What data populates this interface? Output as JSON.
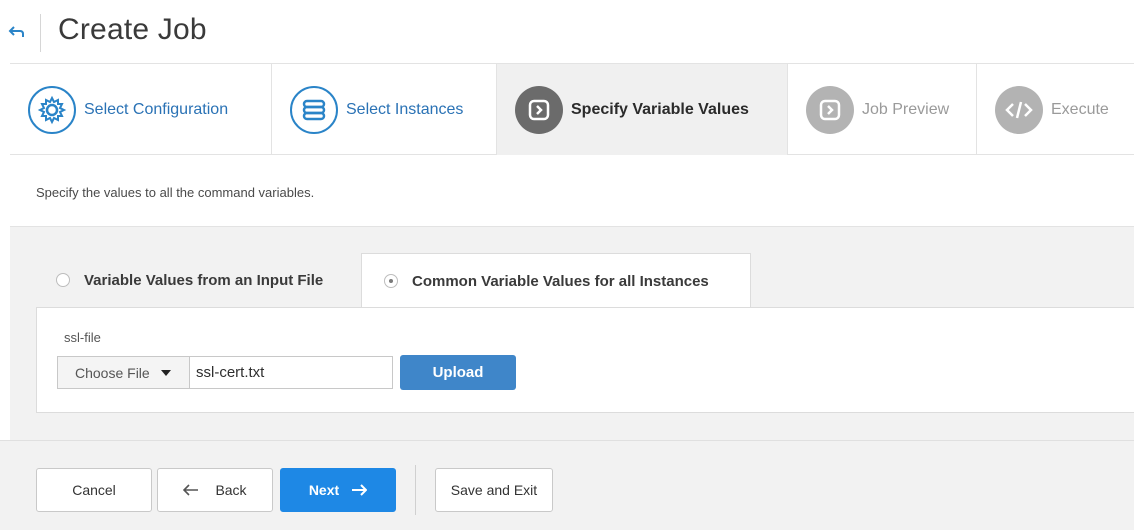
{
  "header": {
    "title": "Create Job",
    "back_icon": "back-arrow-icon"
  },
  "wizard": {
    "steps": [
      {
        "label": "Select Configuration",
        "state": "done",
        "icon": "gear-icon"
      },
      {
        "label": "Select Instances",
        "state": "done",
        "icon": "database-icon"
      },
      {
        "label": "Specify Variable Values",
        "state": "active",
        "icon": "chevron-square-icon"
      },
      {
        "label": "Job Preview",
        "state": "pending",
        "icon": "chevron-square-icon"
      },
      {
        "label": "Execute",
        "state": "pending",
        "icon": "code-icon"
      }
    ]
  },
  "instructions": "Specify the values to all the command variables.",
  "variable_tabs": {
    "file_label": "Variable Values from an Input File",
    "common_label": "Common Variable Values for all Instances",
    "selected": "common"
  },
  "variables": {
    "name": "ssl-file",
    "choose_label": "Choose File",
    "file_value": "ssl-cert.txt",
    "upload_label": "Upload"
  },
  "footer": {
    "cancel_label": "Cancel",
    "back_label": "Back",
    "next_label": "Next",
    "save_exit_label": "Save and Exit"
  },
  "colors": {
    "accent": "#1e88e5",
    "upload": "#3f86c9",
    "step_done": "#2a84c8",
    "step_active": "#6b6b6b",
    "step_pending": "#b3b3b3"
  }
}
